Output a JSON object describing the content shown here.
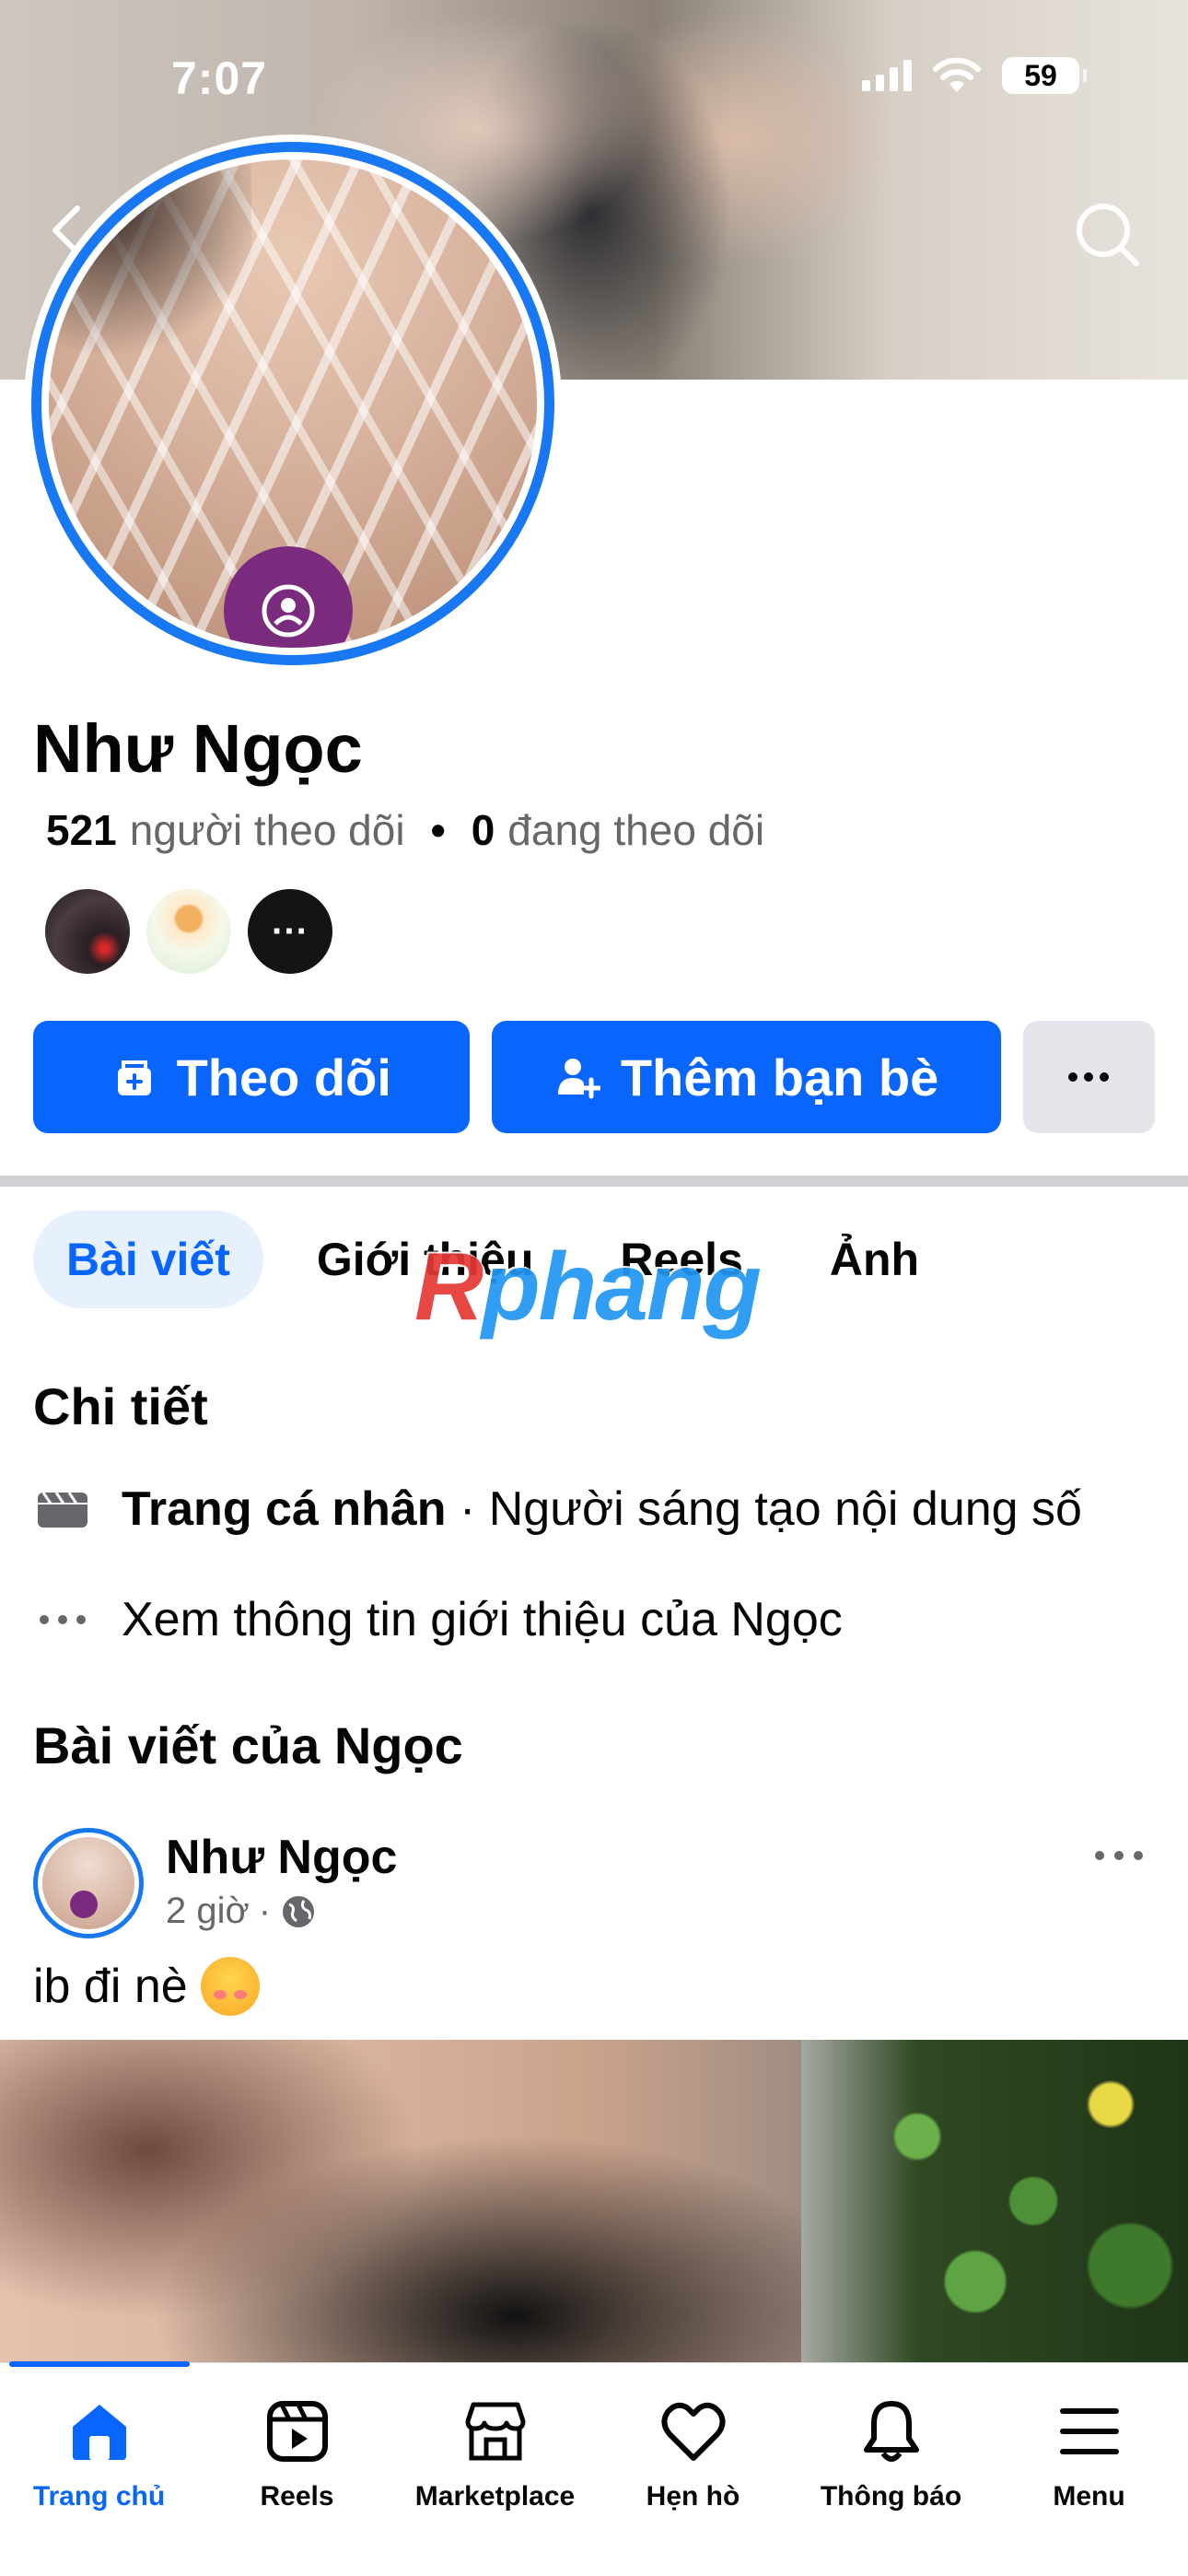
{
  "status_bar": {
    "time": "7:07",
    "battery": "59"
  },
  "profile": {
    "name": "Như Ngọc",
    "followers_count": "521",
    "followers_label": "người theo dõi",
    "following_count": "0",
    "following_label": "đang theo dõi",
    "mutual_more": "···"
  },
  "actions": {
    "follow_label": "Theo dõi",
    "add_friend_label": "Thêm bạn bè",
    "more_label": "···"
  },
  "tabs": [
    {
      "label": "Bài viết",
      "active": true
    },
    {
      "label": "Giới thiệu",
      "active": false
    },
    {
      "label": "Reels",
      "active": false
    },
    {
      "label": "Ảnh",
      "active": false
    }
  ],
  "watermark": {
    "first": "R",
    "rest": "phang"
  },
  "details": {
    "title": "Chi tiết",
    "page_type_label": "Trang cá nhân",
    "page_type_value": " · Người sáng tạo nội dung số",
    "see_about": "Xem thông tin giới thiệu của Ngọc"
  },
  "posts_section": {
    "title": "Bài viết của Ngọc",
    "post": {
      "author": "Như Ngọc",
      "time": "2 giờ",
      "separator": "·",
      "text": "ib đi nè",
      "emoji": "smiling-face-with-hearts-emoji",
      "privacy_icon": "globe-icon"
    }
  },
  "bottom_nav": [
    {
      "label": "Trang chủ",
      "icon": "home-icon",
      "active": true
    },
    {
      "label": "Reels",
      "icon": "reels-icon",
      "active": false
    },
    {
      "label": "Marketplace",
      "icon": "marketplace-icon",
      "active": false
    },
    {
      "label": "Hẹn hò",
      "icon": "heart-icon",
      "active": false
    },
    {
      "label": "Thông báo",
      "icon": "bell-icon",
      "active": false
    },
    {
      "label": "Menu",
      "icon": "menu-icon",
      "active": false
    }
  ],
  "colors": {
    "accent": "#0866ff",
    "ring": "#1877f2",
    "muted_text": "#65676b",
    "secondary_button": "#e4e6eb"
  }
}
